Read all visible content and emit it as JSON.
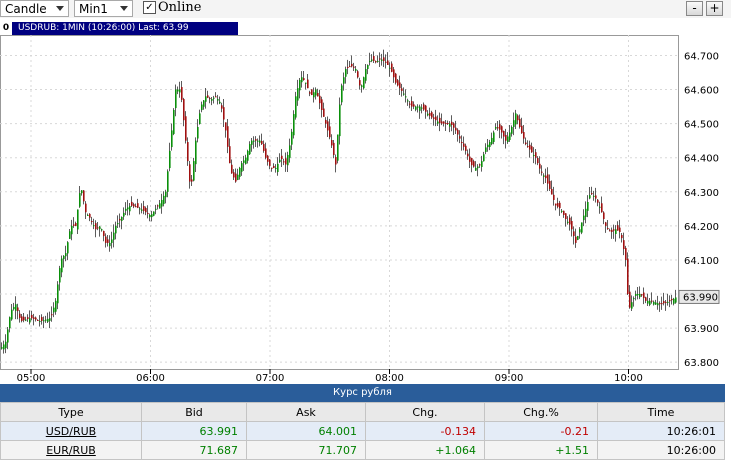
{
  "toolbar": {
    "chart_type": "Candle",
    "timeframe": "Min1",
    "online_checked": true,
    "online_label": "Online",
    "zoom_out": "-",
    "zoom_in": "+"
  },
  "chart": {
    "window_number": "0",
    "title": "USDRUB: 1MIN (10:26:00) Last: 63.99",
    "last_price_label": "63.990"
  },
  "chart_data": {
    "type": "candlestick",
    "symbol": "USDRUB",
    "x_ticks": [
      "05:00",
      "06:00",
      "07:00",
      "08:00",
      "09:00",
      "10:00"
    ],
    "y_ticks": [
      "64.700",
      "64.600",
      "64.500",
      "64.400",
      "64.300",
      "64.200",
      "64.100",
      "64.000",
      "63.900",
      "63.800"
    ],
    "ylim": [
      63.78,
      64.76
    ],
    "grid": true,
    "path_points": [
      [
        0,
        63.84
      ],
      [
        5,
        63.86
      ],
      [
        10,
        63.95
      ],
      [
        15,
        63.97
      ],
      [
        20,
        63.92
      ],
      [
        30,
        63.93
      ],
      [
        40,
        63.92
      ],
      [
        50,
        63.93
      ],
      [
        55,
        63.98
      ],
      [
        60,
        64.1
      ],
      [
        65,
        64.12
      ],
      [
        70,
        64.2
      ],
      [
        75,
        64.2
      ],
      [
        80,
        64.32
      ],
      [
        85,
        64.24
      ],
      [
        90,
        64.22
      ],
      [
        95,
        64.19
      ],
      [
        100,
        64.2
      ],
      [
        105,
        64.15
      ],
      [
        110,
        64.15
      ],
      [
        115,
        64.2
      ],
      [
        120,
        64.22
      ],
      [
        125,
        64.25
      ],
      [
        130,
        64.26
      ],
      [
        140,
        64.25
      ],
      [
        150,
        64.23
      ],
      [
        160,
        64.27
      ],
      [
        165,
        64.3
      ],
      [
        170,
        64.45
      ],
      [
        175,
        64.6
      ],
      [
        180,
        64.6
      ],
      [
        185,
        64.45
      ],
      [
        190,
        64.3
      ],
      [
        195,
        64.45
      ],
      [
        200,
        64.55
      ],
      [
        205,
        64.58
      ],
      [
        210,
        64.57
      ],
      [
        215,
        64.58
      ],
      [
        220,
        64.56
      ],
      [
        225,
        64.48
      ],
      [
        230,
        64.36
      ],
      [
        235,
        64.33
      ],
      [
        240,
        64.38
      ],
      [
        245,
        64.4
      ],
      [
        250,
        64.45
      ],
      [
        260,
        64.45
      ],
      [
        265,
        64.4
      ],
      [
        270,
        64.37
      ],
      [
        275,
        64.37
      ],
      [
        280,
        64.4
      ],
      [
        285,
        64.38
      ],
      [
        290,
        64.45
      ],
      [
        295,
        64.58
      ],
      [
        300,
        64.64
      ],
      [
        305,
        64.62
      ],
      [
        310,
        64.58
      ],
      [
        315,
        64.6
      ],
      [
        320,
        64.55
      ],
      [
        325,
        64.5
      ],
      [
        330,
        64.45
      ],
      [
        335,
        64.38
      ],
      [
        340,
        64.6
      ],
      [
        345,
        64.66
      ],
      [
        350,
        64.67
      ],
      [
        355,
        64.66
      ],
      [
        360,
        64.6
      ],
      [
        365,
        64.66
      ],
      [
        370,
        64.69
      ],
      [
        375,
        64.68
      ],
      [
        380,
        64.69
      ],
      [
        385,
        64.68
      ],
      [
        390,
        64.66
      ],
      [
        395,
        64.62
      ],
      [
        400,
        64.6
      ],
      [
        405,
        64.58
      ],
      [
        410,
        64.55
      ],
      [
        420,
        64.55
      ],
      [
        430,
        64.52
      ],
      [
        440,
        64.5
      ],
      [
        450,
        64.5
      ],
      [
        455,
        64.48
      ],
      [
        460,
        64.45
      ],
      [
        465,
        64.42
      ],
      [
        470,
        64.38
      ],
      [
        475,
        64.37
      ],
      [
        480,
        64.38
      ],
      [
        485,
        64.43
      ],
      [
        490,
        64.45
      ],
      [
        495,
        64.49
      ],
      [
        500,
        64.48
      ],
      [
        505,
        64.45
      ],
      [
        510,
        64.48
      ],
      [
        515,
        64.53
      ],
      [
        520,
        64.48
      ],
      [
        525,
        64.44
      ],
      [
        530,
        64.42
      ],
      [
        535,
        64.4
      ],
      [
        540,
        64.36
      ],
      [
        545,
        64.34
      ],
      [
        550,
        64.3
      ],
      [
        555,
        64.26
      ],
      [
        560,
        64.25
      ],
      [
        565,
        64.22
      ],
      [
        570,
        64.2
      ],
      [
        575,
        64.15
      ],
      [
        580,
        64.2
      ],
      [
        585,
        64.25
      ],
      [
        590,
        64.3
      ],
      [
        595,
        64.28
      ],
      [
        600,
        64.25
      ],
      [
        605,
        64.2
      ],
      [
        610,
        64.18
      ],
      [
        615,
        64.19
      ],
      [
        620,
        64.18
      ],
      [
        625,
        64.1
      ],
      [
        628,
        63.95
      ],
      [
        630,
        63.97
      ],
      [
        635,
        64.0
      ],
      [
        640,
        64.0
      ],
      [
        645,
        63.98
      ],
      [
        650,
        63.98
      ],
      [
        660,
        63.97
      ],
      [
        670,
        63.98
      ],
      [
        675,
        63.99
      ]
    ]
  },
  "rates_panel": {
    "title": "Курс рубля",
    "columns": [
      "Type",
      "Bid",
      "Ask",
      "Chg.",
      "Chg.%",
      "Time"
    ],
    "rows": [
      {
        "type": "USD/RUB",
        "bid": "63.991",
        "ask": "64.001",
        "chg": "-0.134",
        "chg_pct": "-0.21",
        "time": "10:26:01"
      },
      {
        "type": "EUR/RUB",
        "bid": "71.687",
        "ask": "71.707",
        "chg": "+1.064",
        "chg_pct": "+1.51",
        "time": "10:26:00"
      }
    ]
  },
  "colors": {
    "bull": "#0a8f0a",
    "bear": "#a01010",
    "title_bar": "#000080",
    "panel_header": "#2a5d9a",
    "grid": "#d8d8d8"
  }
}
